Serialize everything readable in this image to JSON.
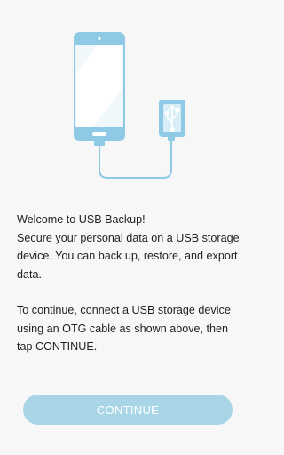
{
  "illustration": {
    "phone_icon": "phone-icon",
    "usb_drive_icon": "usb-drive-icon",
    "usb_symbol_icon": "usb-symbol-icon",
    "accent_color": "#8ecae6"
  },
  "intro": {
    "line1": "Welcome to USB Backup!",
    "line2": "Secure your personal data on a USB storage device. You can back up, restore, and export data.",
    "line3": "To continue, connect a USB storage device using an OTG cable as shown above, then tap CONTINUE."
  },
  "actions": {
    "continue_label": "CONTINUE",
    "continue_bg": "#a8d6e7"
  }
}
